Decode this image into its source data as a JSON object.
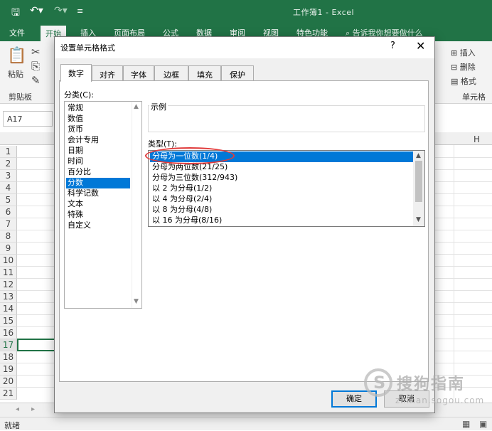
{
  "app": {
    "window_title": "工作簿1 - Excel",
    "ribbon_tabs": [
      "文件",
      "开始",
      "插入",
      "页面布局",
      "公式",
      "数据",
      "审阅",
      "视图",
      "特色功能"
    ],
    "active_ribbon_tab": "开始",
    "tell_me": "告诉我你想要做什么",
    "accent_color": "#217346"
  },
  "ribbon": {
    "paste": "粘贴",
    "clipboard_group": "剪贴板",
    "insert": "插入",
    "delete": "删除",
    "format": "格式",
    "cells_group": "单元格"
  },
  "formula_bar": {
    "name_box": "A17"
  },
  "grid": {
    "visible_column": "H",
    "rows": [
      "1",
      "2",
      "3",
      "4",
      "5",
      "6",
      "7",
      "8",
      "9",
      "10",
      "11",
      "12",
      "13",
      "14",
      "15",
      "16",
      "17",
      "18",
      "19",
      "20",
      "21"
    ],
    "selected_row": "17"
  },
  "status_bar": {
    "text": "就绪"
  },
  "dialog": {
    "title": "设置单元格格式",
    "help": "?",
    "tabs": [
      "数字",
      "对齐",
      "字体",
      "边框",
      "填充",
      "保护"
    ],
    "active_tab": "数字",
    "category_label": "分类(C):",
    "categories": [
      "常规",
      "数值",
      "货币",
      "会计专用",
      "日期",
      "时间",
      "百分比",
      "分数",
      "科学记数",
      "文本",
      "特殊",
      "自定义"
    ],
    "selected_category": "分数",
    "sample_label": "示例",
    "type_label": "类型(T):",
    "types": [
      "分母为一位数(1/4)",
      "分母为两位数(21/25)",
      "分母为三位数(312/943)",
      "以 2 为分母(1/2)",
      "以 4 为分母(2/4)",
      "以 8 为分母(4/8)",
      "以 16 为分母(8/16)"
    ],
    "selected_type": "分母为一位数(1/4)",
    "ok": "确定",
    "cancel": "取消",
    "selection_color": "#0078d7",
    "highlight_color": "#e03b3b"
  },
  "watermark": {
    "text": "搜狗指南",
    "url": "zhinan.sogou.com"
  }
}
